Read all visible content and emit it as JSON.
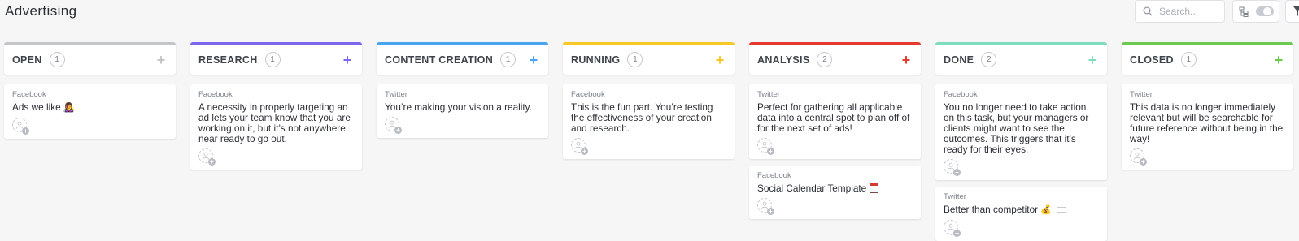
{
  "header": {
    "title": "Advertising",
    "search_placeholder": "Search..."
  },
  "columns": [
    {
      "name": "OPEN",
      "count": "1",
      "color": "#c3c5c9",
      "cards": [
        {
          "source": "Facebook",
          "title": "Ads we like",
          "emoji": "👩‍🎤",
          "has_description": true
        }
      ]
    },
    {
      "name": "RESEARCH",
      "count": "1",
      "color": "#7b68ee",
      "cards": [
        {
          "source": "Facebook",
          "title": "A necessity in properly targeting an ad lets your team know that you are working on it, but it’s not anywhere near ready to go out.",
          "emoji": "",
          "has_description": false
        }
      ]
    },
    {
      "name": "CONTENT CREATION",
      "count": "1",
      "color": "#49a5f2",
      "cards": [
        {
          "source": "Twitter",
          "title": "You’re making your vision a reality.",
          "emoji": "",
          "has_description": false
        }
      ]
    },
    {
      "name": "RUNNING",
      "count": "1",
      "color": "#f7c925",
      "cards": [
        {
          "source": "Facebook",
          "title": "This is the fun part. You’re testing the effectiveness of your creation and research.",
          "emoji": "",
          "has_description": false
        }
      ]
    },
    {
      "name": "ANALYSIS",
      "count": "2",
      "color": "#e43a30",
      "cards": [
        {
          "source": "Twitter",
          "title": "Perfect for gathering all applicable data into a central spot to plan off of for the next set of ads!",
          "emoji": "",
          "has_description": false
        },
        {
          "source": "Facebook",
          "title": "Social Calendar Template",
          "emoji": "calendar",
          "has_description": false
        }
      ]
    },
    {
      "name": "DONE",
      "count": "2",
      "color": "#7fdcc0",
      "cards": [
        {
          "source": "Facebook",
          "title": "You no longer need to take action on this task, but your managers or clients might want to see the outcomes. This triggers that it’s ready for their eyes.",
          "emoji": "",
          "has_description": false
        },
        {
          "source": "Twitter",
          "title": "Better than competitor",
          "emoji": "💰",
          "has_description": true
        }
      ]
    },
    {
      "name": "CLOSED",
      "count": "1",
      "color": "#6bc950",
      "cards": [
        {
          "source": "Twitter",
          "title": "This data is no longer immediately relevant but will be searchable for future reference without being in the way!",
          "emoji": "",
          "has_description": false
        }
      ]
    }
  ]
}
